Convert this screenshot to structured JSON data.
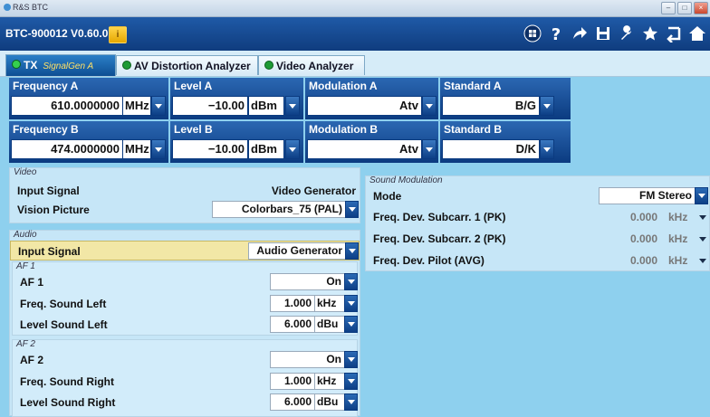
{
  "window": {
    "title": "R&S BTC",
    "device": "BTC-900012 V0.60.0.0"
  },
  "tabs": [
    {
      "label": "TX",
      "sub": "SignalGen A"
    },
    {
      "label": "AV Distortion Analyzer"
    },
    {
      "label": "Video Analyzer"
    }
  ],
  "settings": {
    "freq_a": {
      "label": "Frequency A",
      "value": "610.0000000",
      "unit": "MHz"
    },
    "level_a": {
      "label": "Level A",
      "value": "−10.00",
      "unit": "dBm"
    },
    "mod_a": {
      "label": "Modulation A",
      "value": "Atv"
    },
    "std_a": {
      "label": "Standard A",
      "value": "B/G"
    },
    "freq_b": {
      "label": "Frequency B",
      "value": "474.0000000",
      "unit": "MHz"
    },
    "level_b": {
      "label": "Level B",
      "value": "−10.00",
      "unit": "dBm"
    },
    "mod_b": {
      "label": "Modulation B",
      "value": "Atv"
    },
    "std_b": {
      "label": "Standard B",
      "value": "D/K"
    }
  },
  "video": {
    "title": "Video",
    "input_label": "Input Signal",
    "input_value": "Video Generator",
    "vision_label": "Vision Picture",
    "vision_value": "Colorbars_75 (PAL)"
  },
  "audio": {
    "title": "Audio",
    "input_label": "Input Signal",
    "input_value": "Audio Generator",
    "af1": {
      "title": "AF 1",
      "label": "AF 1",
      "value": "On",
      "freq_label": "Freq. Sound Left",
      "freq_value": "1.000",
      "freq_unit": "kHz",
      "level_label": "Level Sound Left",
      "level_value": "6.000",
      "level_unit": "dBu"
    },
    "af2": {
      "title": "AF 2",
      "label": "AF 2",
      "value": "On",
      "freq_label": "Freq. Sound Right",
      "freq_value": "1.000",
      "freq_unit": "kHz",
      "level_label": "Level Sound Right",
      "level_value": "6.000",
      "level_unit": "dBu"
    }
  },
  "sound": {
    "title": "Sound Modulation",
    "mode_label": "Mode",
    "mode_value": "FM Stereo",
    "dev1_label": "Freq. Dev. Subcarr. 1 (PK)",
    "dev1_value": "0.000",
    "dev1_unit": "kHz",
    "dev2_label": "Freq. Dev. Subcarr. 2 (PK)",
    "dev2_value": "0.000",
    "dev2_unit": "kHz",
    "pilot_label": "Freq. Dev. Pilot (AVG)",
    "pilot_value": "0.000",
    "pilot_unit": "kHz"
  },
  "icons": [
    "windows-icon",
    "help-icon",
    "share-icon",
    "save-icon",
    "wrench-icon",
    "star-icon",
    "back-icon",
    "home-icon"
  ]
}
